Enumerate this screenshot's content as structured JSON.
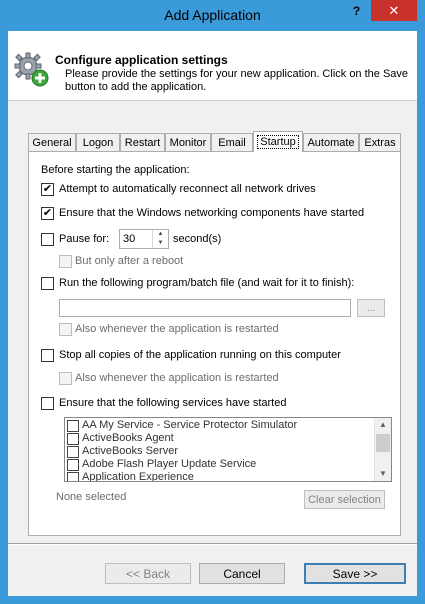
{
  "window": {
    "title": "Add Application",
    "help_label": "?",
    "close_label": "✕"
  },
  "header": {
    "title": "Configure application settings",
    "description": "Please provide the settings for your new application. Click on the Save button to add the application.",
    "icon": "gear-add-icon"
  },
  "tabs": [
    "General",
    "Logon",
    "Restart",
    "Monitor",
    "Email",
    "Startup",
    "Automate",
    "Extras"
  ],
  "active_tab": "Startup",
  "startup": {
    "intro": "Before starting the application:",
    "reconnect_drives": {
      "label": "Attempt to automatically reconnect all network drives",
      "checked": true
    },
    "networking": {
      "label": "Ensure that the Windows networking components have started",
      "checked": true
    },
    "pause": {
      "label": "Pause for:",
      "value": "30",
      "unit": "second(s)",
      "checked": false
    },
    "pause_reboot": {
      "label": "But only after a reboot",
      "checked": false
    },
    "run_program": {
      "label": "Run the following program/batch file (and wait for it to finish):",
      "checked": false,
      "value": "",
      "browse_label": "..."
    },
    "run_also_restart": {
      "label": "Also whenever the application is restarted",
      "checked": false
    },
    "stop_copies": {
      "label": "Stop all copies of the application running on this computer",
      "checked": false
    },
    "stop_also_restart": {
      "label": "Also whenever the application is restarted",
      "checked": false
    },
    "services": {
      "label": "Ensure that the following services have started",
      "checked": false
    },
    "service_list": [
      "AA My Service - Service Protector Simulator",
      "ActiveBooks Agent",
      "ActiveBooks Server",
      "Adobe Flash Player Update Service",
      "Application Experience"
    ],
    "selection_status": "None selected",
    "clear_selection_label": "Clear selection"
  },
  "footer": {
    "back_label": "<< Back",
    "cancel_label": "Cancel",
    "save_label": "Save >>"
  },
  "colors": {
    "titlebar": "#3b9ad9",
    "close": "#c7312a",
    "panel": "#ffffff",
    "dialog": "#f0f0f0"
  }
}
